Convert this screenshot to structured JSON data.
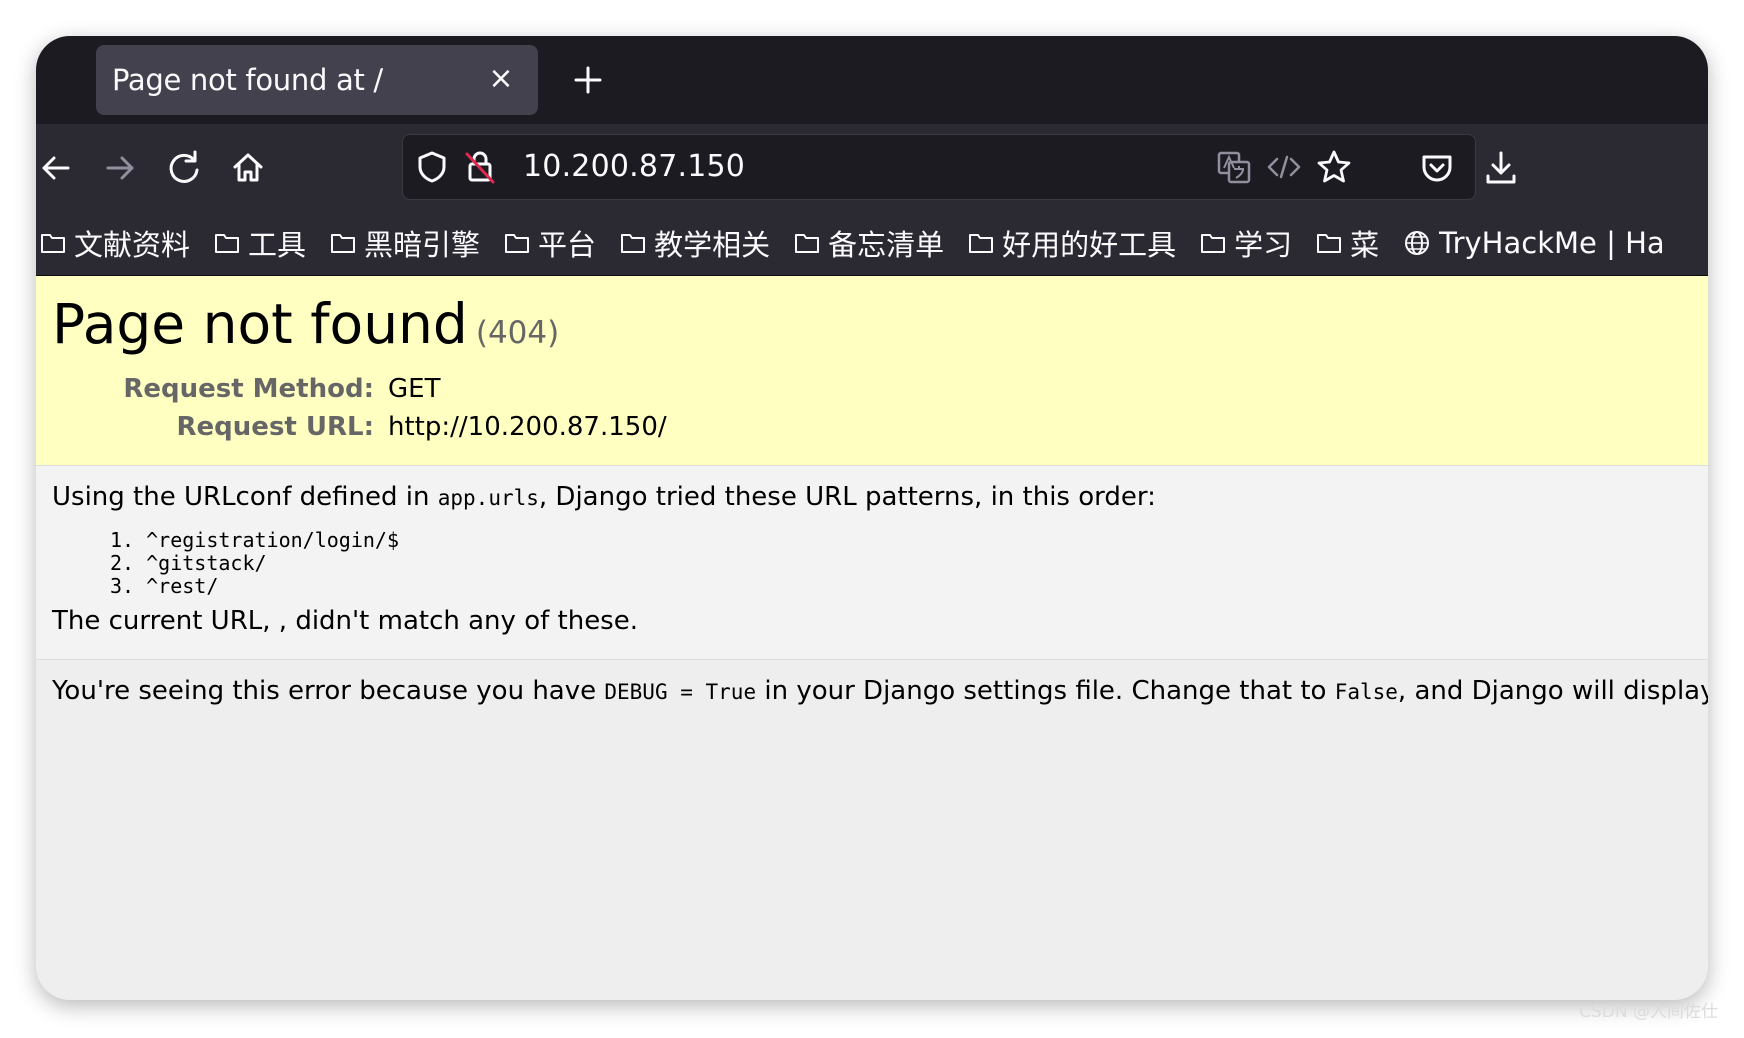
{
  "browser": {
    "tab": {
      "title": "Page not found at /",
      "close_glyph": "×"
    },
    "url": "10.200.87.150",
    "bookmarks": [
      {
        "label": "文献资料",
        "icon": "folder-icon"
      },
      {
        "label": "工具",
        "icon": "folder-icon"
      },
      {
        "label": "黑暗引擎",
        "icon": "folder-icon"
      },
      {
        "label": "平台",
        "icon": "folder-icon"
      },
      {
        "label": "教学相关",
        "icon": "folder-icon"
      },
      {
        "label": "备忘清单",
        "icon": "folder-icon"
      },
      {
        "label": "好用的好工具",
        "icon": "folder-icon"
      },
      {
        "label": "学习",
        "icon": "folder-icon"
      },
      {
        "label": "菜",
        "icon": "folder-icon"
      },
      {
        "label": "TryHackMe | Ha",
        "icon": "globe-icon"
      }
    ]
  },
  "page": {
    "heading": "Page not found",
    "status_code": "(404)",
    "request_method_label": "Request Method:",
    "request_method": "GET",
    "request_url_label": "Request URL:",
    "request_url": "http://10.200.87.150/",
    "urlconf_prefix": "Using the URLconf defined in ",
    "urlconf_module": "app.urls",
    "urlconf_suffix": ", Django tried these URL patterns, in this order:",
    "patterns": [
      "1. ^registration/login/$",
      "2. ^gitstack/",
      "3. ^rest/"
    ],
    "no_match": "The current URL, , didn't match any of these.",
    "debug_prefix": "You're seeing this error because you have ",
    "debug_code": "DEBUG = True",
    "debug_middle": " in your Django settings file. Change that to ",
    "debug_false": "False",
    "debug_suffix": ", and Django will display"
  },
  "watermark": "CSDN @人间佐仕"
}
